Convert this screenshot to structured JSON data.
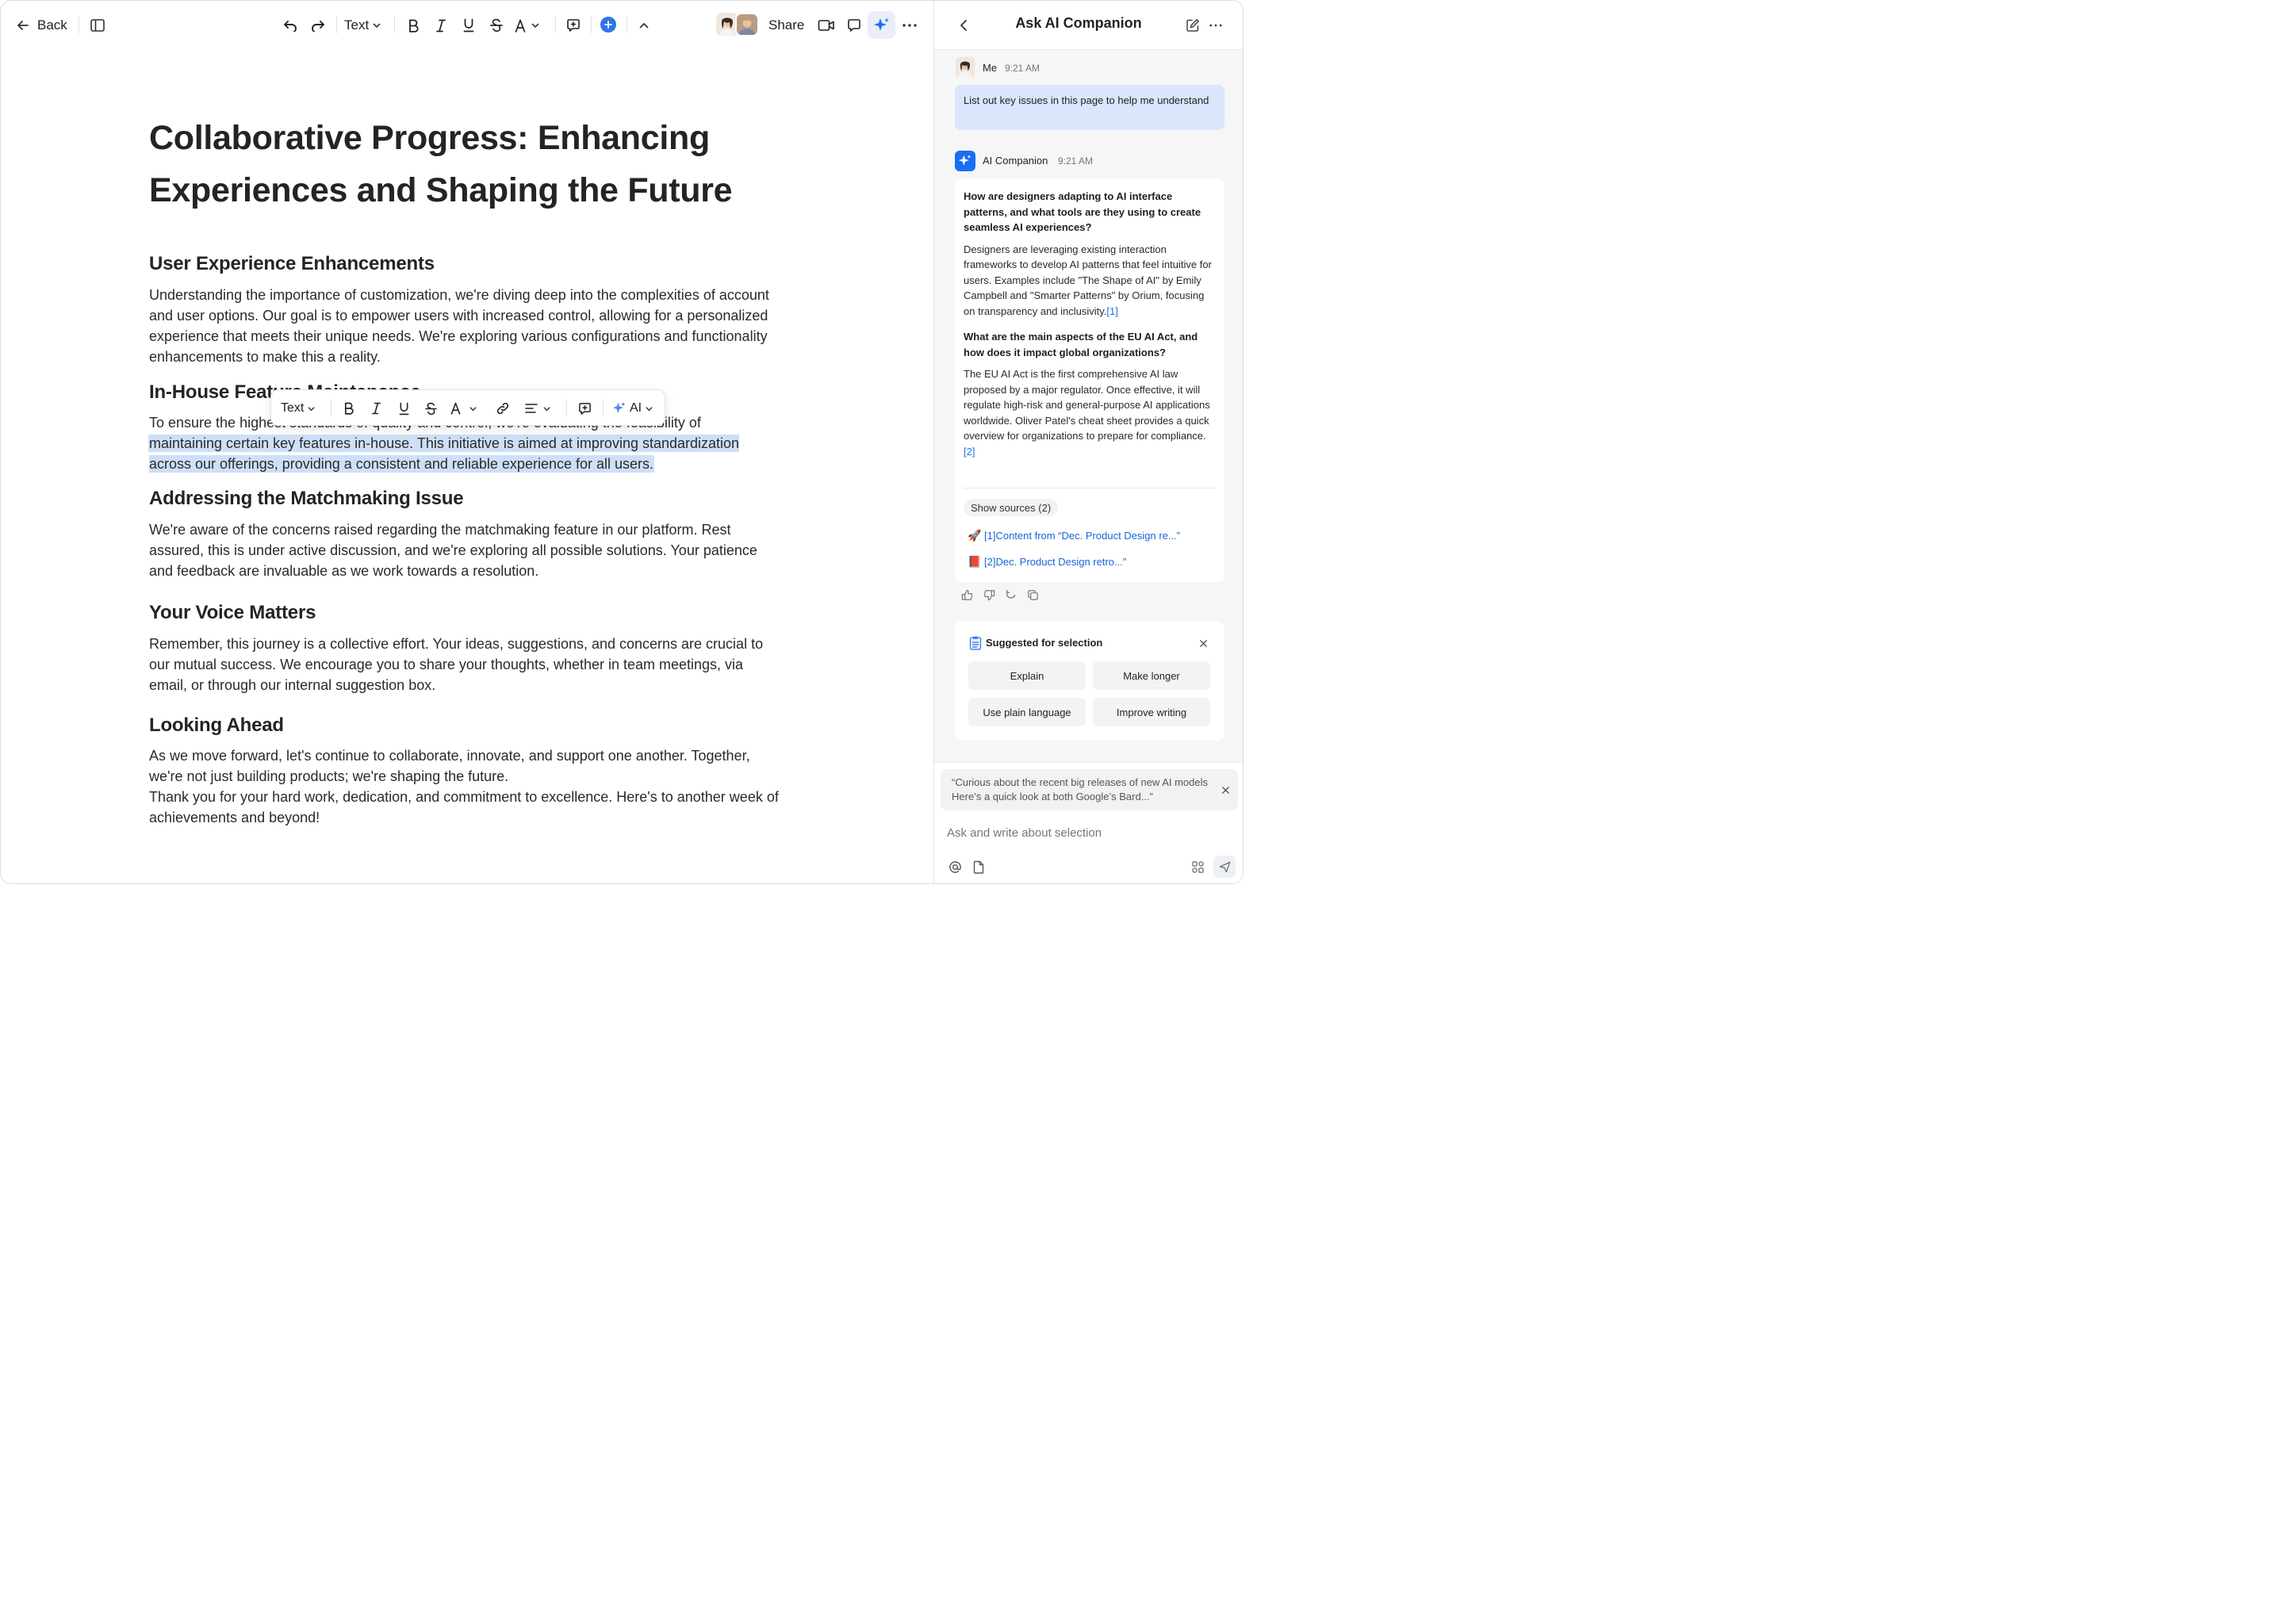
{
  "toolbar": {
    "back_label": "Back",
    "text_style_label": "Text",
    "share_label": "Share"
  },
  "document": {
    "title": "Collaborative Progress: Enhancing Experiences and Shaping the Future",
    "sections": [
      {
        "heading": "User Experience Enhancements",
        "body": "Understanding the importance of customization, we're diving deep into the complexities of account and user options. Our goal is to empower users with increased control, allowing for a personalized experience that meets their unique needs. We're exploring various configurations and functionality enhancements to make this a reality."
      },
      {
        "heading": "In-House Feature Maintenance",
        "body_before": "To ensure the highest standards of quality and control, we're evaluating the feasibility of ",
        "body_selected": "maintaining certain key features in-house. This initiative is aimed at improving standardization across our offerings, providing a consistent and reliable experience for all users."
      },
      {
        "heading": "Addressing the Matchmaking Issue",
        "body": "We're aware of the concerns raised regarding the matchmaking feature in our platform. Rest assured, this is under active discussion, and we're exploring all possible solutions. Your patience and feedback are invaluable as we work towards a resolution."
      },
      {
        "heading": "Your Voice Matters",
        "body": "Remember, this journey is a collective effort. Your ideas, suggestions, and concerns are crucial to our mutual success. We encourage you to share your thoughts, whether in team meetings, via email, or through our internal suggestion box."
      },
      {
        "heading": "Looking Ahead",
        "body": "As we move forward, let's continue to collaborate, innovate, and support one another. Together, we're not just building products; we're shaping the future.",
        "body2": "Thank you for your hard work, dedication, and commitment to excellence. Here's to another week of achievements and beyond!"
      }
    ]
  },
  "floating_toolbar": {
    "text_style_label": "Text",
    "ai_label": "AI"
  },
  "sidebar": {
    "title": "Ask AI Companion",
    "user_message": {
      "author": "Me",
      "time": "9:21 AM",
      "text": "List out key issues in this page to help me understand"
    },
    "ai_message": {
      "author": "AI Companion",
      "time": "9:21 AM",
      "q1": "How are designers adapting to AI interface patterns, and what tools are they using to create seamless AI experiences?",
      "a1": "Designers are leveraging existing interaction frameworks to develop AI patterns that feel intuitive for users. Examples include \"The Shape of AI\" by Emily Campbell and \"Smarter Patterns\" by Orium, focusing on transparency and inclusivity.",
      "a1_ref": "[1]",
      "q2": "What are the main aspects of the EU AI Act, and how does it impact global organizations?",
      "a2": "The EU AI Act is the first comprehensive AI law proposed by a major regulator. Once effective, it will regulate high-risk and general-purpose AI applications worldwide. Oliver Patel's cheat sheet provides a quick overview for organizations to prepare for compliance.",
      "a2_ref": "[2]",
      "show_sources_label": "Show sources (2)",
      "sources": [
        {
          "emoji": "🚀",
          "text": "[1]Content from “Dec. Product Design re...”"
        },
        {
          "emoji": "📕",
          "text": "[2]Dec. Product Design retro...”"
        }
      ]
    },
    "suggested": {
      "title": "Suggested for selection",
      "buttons": [
        "Explain",
        "Make longer",
        "Use plain language",
        "Improve writing"
      ]
    },
    "quote_chip": "“Curious about the recent big releases of new AI models Here’s a quick look at both Google’s Bard...”",
    "input_placeholder": "Ask and write about selection"
  },
  "colors": {
    "accent": "#1a6ef5",
    "selection": "#cde0f7",
    "user_bubble": "#d9e6fb",
    "link": "#1a63d8"
  }
}
